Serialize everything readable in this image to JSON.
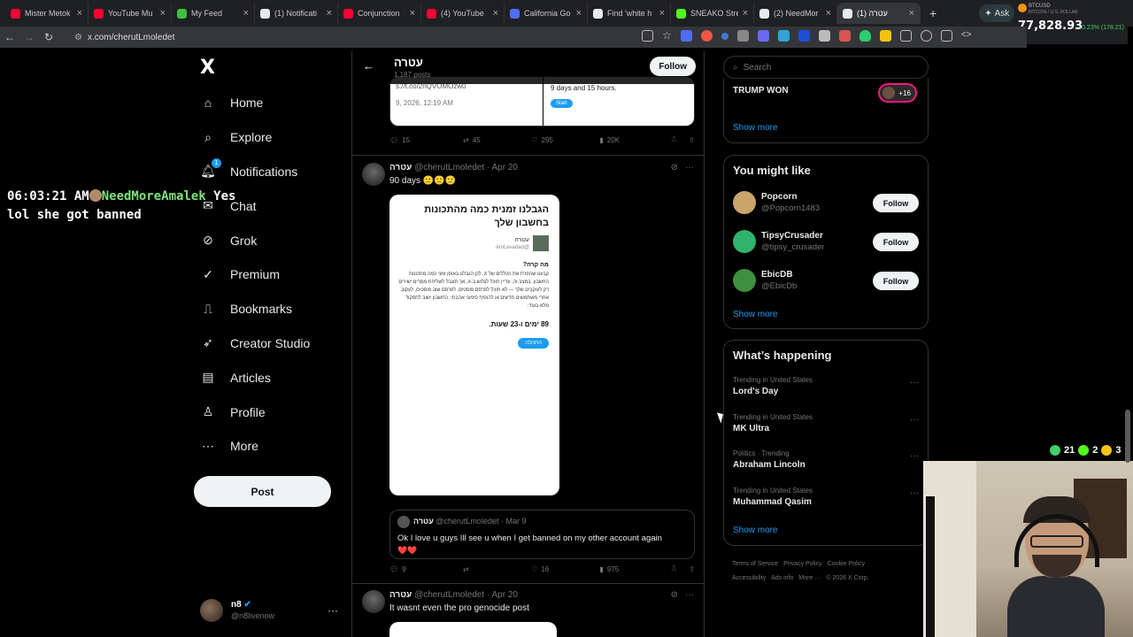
{
  "browser": {
    "tabs": [
      {
        "label": "Mister Metok",
        "color": "#ff0033"
      },
      {
        "label": "YouTube Mu",
        "color": "#ff0033"
      },
      {
        "label": "My Feed",
        "color": "#3fbf3f"
      },
      {
        "label": "(1) Notificati",
        "color": "#e7e9ea"
      },
      {
        "label": "Conjunction",
        "color": "#ff0033"
      },
      {
        "label": "(4) YouTube",
        "color": "#ff0033"
      },
      {
        "label": "California Go",
        "color": "#4f6ef7"
      },
      {
        "label": "Find 'white h",
        "color": "#e7e9ea"
      },
      {
        "label": "SNEAKO Stre",
        "color": "#53fc18"
      },
      {
        "label": "(2) NeedMor",
        "color": "#e7e9ea"
      },
      {
        "label": "(1) עטרה",
        "color": "#e7e9ea"
      }
    ],
    "new_tab": "+",
    "ask_label": "Ask",
    "url": "x.com/cherutLmoledet",
    "btc": {
      "name": "BTCUSD",
      "sub": "BITCOIN / U.S. DOLLAR",
      "value": "77,828.93",
      "change": "+0.23% (178.21)"
    }
  },
  "nav": {
    "logo": "X",
    "items": [
      {
        "label": "Home",
        "icon": "home-icon"
      },
      {
        "label": "Explore",
        "icon": "search-icon"
      },
      {
        "label": "Notifications",
        "icon": "bell-icon",
        "badge": "1"
      },
      {
        "label": "Chat",
        "icon": "chat-icon"
      },
      {
        "label": "Grok",
        "icon": "grok-icon"
      },
      {
        "label": "Premium",
        "icon": "verified-icon"
      },
      {
        "label": "Bookmarks",
        "icon": "bookmark-icon"
      },
      {
        "label": "Creator Studio",
        "icon": "rocket-icon"
      },
      {
        "label": "Articles",
        "icon": "article-icon"
      },
      {
        "label": "Profile",
        "icon": "person-icon"
      },
      {
        "label": "More",
        "icon": "more-icon"
      }
    ],
    "post_label": "Post",
    "me": {
      "name": "n8",
      "handle": "@n8livenow"
    }
  },
  "overlay": {
    "time": "06:03:21 AM",
    "user": "NeedMoreAmalek",
    "msg1": "Yes",
    "msg2": "lol she got banned"
  },
  "timeline": {
    "header_title": "עטרה",
    "header_sub": "1,187 posts",
    "follow_label": "Follow",
    "prev_card": {
      "left_link": "s://t.co/2nQVOMOzw0",
      "left_date": "9, 2026, 12:19 AM",
      "right_text": "9 days and 15 hours.",
      "right_btn": "Start"
    },
    "prev_actions": {
      "replies": "15",
      "reposts": "45",
      "likes": "295",
      "views": "20K"
    },
    "tweet1": {
      "name": "עטרה",
      "handle": "@cherutLmoledet",
      "date": "· Apr 20",
      "text": "90 days 🙁🙁🙁",
      "shot": {
        "title": "הגבלנו זמנית כמה מהתכונות בחשבון שלך",
        "author": "עטרה",
        "author_handle": "@AmLevadad",
        "question": "מה קרה?",
        "body": "קבענו שהפרת את הכללים של X, לכן הגבלנו באופן זמני כמה מתכונות החשבון. במצב זה, עדיין תוכל לגלוש ב-X, אך תוגבל לשליחת מסרים ישירים רק לעוקבים שלך — לא תוכל לפרסם פוסטים, לפרסם שוב פוסטים, לעקוב אחרי משתמשים חדשים או להוסיף סימוני אהבתי. החשבון ישוב לתפקוד מלא בעוד:",
        "duration": "89 ימים ו-23 שעות.",
        "button": "התחלה"
      },
      "quote": {
        "name": "עטרה",
        "handle": "@cherutLmoledet · Mar 9",
        "text": "Ok I love u guys Ill see u when I get banned on my other account again",
        "emoji": "❤️❤️"
      },
      "actions": {
        "replies": "9",
        "reposts": "",
        "likes": "16",
        "views": "975"
      }
    },
    "tweet2": {
      "name": "עטרה",
      "handle": "@cherutLmoledet",
      "date": "· Apr 20",
      "text": "It wasnt even the pro genocide post"
    }
  },
  "right": {
    "search_placeholder": "Search",
    "trump": {
      "label": "TRUMP WON",
      "count": "+16",
      "show_more": "Show more"
    },
    "might_like": {
      "title": "You might like",
      "people": [
        {
          "name": "Popcorn",
          "handle": "@Popcorn1483",
          "color": "#c9a46b",
          "follow": "Follow"
        },
        {
          "name": "TipsyCrusader",
          "handle": "@tipsy_crusader",
          "color": "#2fb36b",
          "follow": "Follow"
        },
        {
          "name": "EbicDB",
          "handle": "@EbicDb",
          "color": "#3e8f3e",
          "follow": "Follow"
        }
      ],
      "show_more": "Show more"
    },
    "happening": {
      "title": "What’s happening",
      "trends": [
        {
          "meta": "Trending in United States",
          "name": "Lord's Day"
        },
        {
          "meta": "Trending in United States",
          "name": "MK Ultra"
        },
        {
          "meta": "Politics · Trending",
          "name": "Abraham Lincoln"
        },
        {
          "meta": "Trending in United States",
          "name": "Muhammad Qasim"
        }
      ],
      "show_more": "Show more"
    },
    "footer": {
      "links": [
        "Terms of Service",
        "Privacy Policy",
        "Cookie Policy",
        "Accessibility",
        "Ads info",
        "More ···"
      ],
      "copyright": "© 2026 X Corp."
    }
  },
  "stream": {
    "stat1": "21",
    "stat2": "2",
    "stat3": "3"
  }
}
